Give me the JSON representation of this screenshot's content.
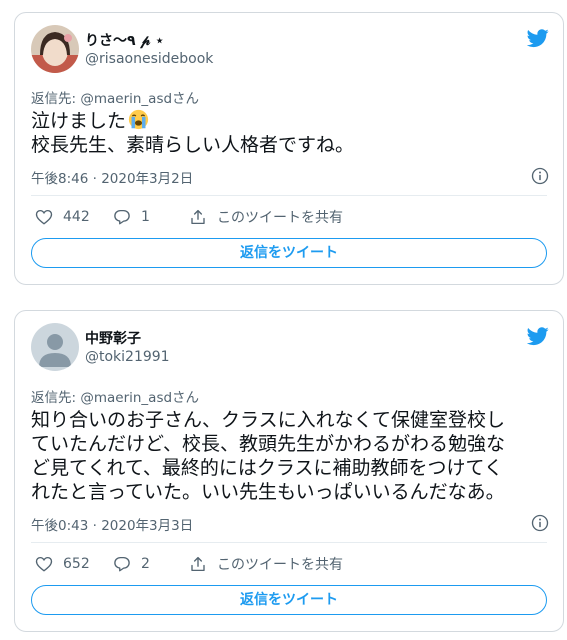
{
  "colors": {
    "brand_blue": "#1d9bf0",
    "secondary_text": "#536471",
    "border": "#d3d9de"
  },
  "tweets": [
    {
      "display_name": "りさ〜٩ 𝓅 ⋆",
      "handle": "@risaonesidebook",
      "avatar_icon": "user-photo-avatar",
      "reply_to": "返信先: @maerin_asdさん",
      "text_lines": [
        "泣けました",
        "校長先生、素晴らしい人格者ですね。"
      ],
      "emoji": "loudly-crying-face-emoji",
      "timestamp": "午後8:46 · 2020年3月2日",
      "likes": "442",
      "replies": "1",
      "share_label": "このツイートを共有",
      "reply_button_label": "返信をツイート"
    },
    {
      "display_name": "中野彰子",
      "handle": "@toki21991",
      "avatar_icon": "default-avatar",
      "reply_to": "返信先: @maerin_asdさん",
      "text_lines": [
        "知り合いのお子さん、クラスに入れなくて保健室登校し",
        "ていたんだけど、校長、教頭先生がかわるがわる勉強な",
        "ど見てくれて、最終的にはクラスに補助教師をつけてく",
        "れたと言っていた。いい先生もいっぱいいるんだなあ。"
      ],
      "timestamp": "午後0:43 · 2020年3月3日",
      "likes": "652",
      "replies": "2",
      "share_label": "このツイートを共有",
      "reply_button_label": "返信をツイート"
    }
  ]
}
